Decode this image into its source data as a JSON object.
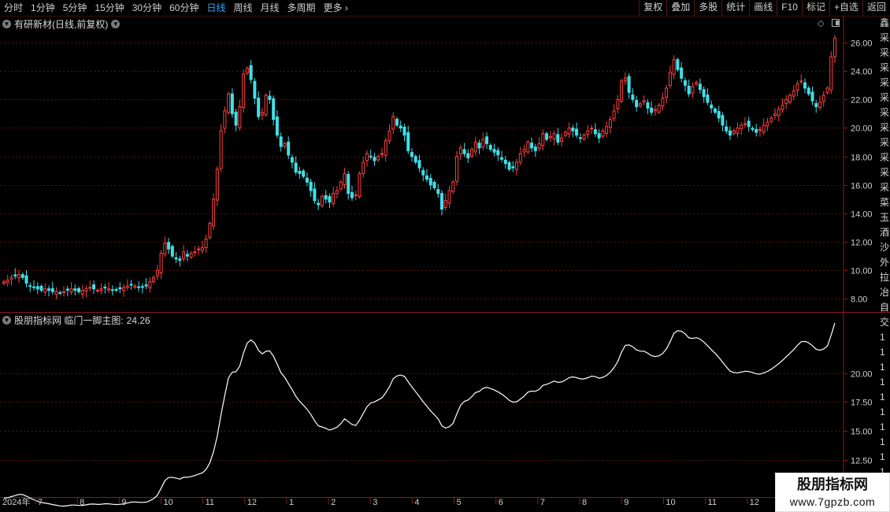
{
  "toolbar": {
    "periods": [
      "分时",
      "1分钟",
      "5分钟",
      "15分钟",
      "30分钟",
      "60分钟",
      "日线",
      "周线",
      "月线",
      "多周期",
      "更多"
    ],
    "active_period": "日线",
    "more_arrow": "›",
    "actions": [
      "复权",
      "叠加",
      "多股",
      "统计",
      "画线",
      "F10",
      "标记",
      "+自选",
      "返回"
    ]
  },
  "main_panel": {
    "title": "有研新材(日线,前复权)",
    "y_ticks": [
      "26.00",
      "24.00",
      "22.00",
      "20.00",
      "18.00",
      "16.00",
      "14.00",
      "12.00",
      "10.00",
      "8.00"
    ]
  },
  "sub_panel": {
    "title": "股朋指标网 临门一脚主图:",
    "value": "24.26",
    "y_ticks": [
      "20.00",
      "17.50",
      "15.00",
      "12.50"
    ]
  },
  "date_axis": {
    "labels": [
      "2024年",
      "7",
      "8",
      "9",
      "10",
      "11",
      "12",
      "1",
      "2",
      "3",
      "4",
      "5",
      "6",
      "7",
      "8",
      "9",
      "10",
      "11",
      "12",
      "1"
    ]
  },
  "right_strip": {
    "glyphs": [
      "鑫",
      "采",
      "采",
      "采",
      "采",
      "采",
      "采",
      "采",
      "采",
      "采",
      "采",
      "采",
      "菜",
      "玉",
      "酒",
      "沙",
      "外",
      "拉",
      "冶",
      "自",
      "交",
      "1",
      "1",
      "1",
      "1",
      "1",
      "1",
      "1",
      "1",
      "1",
      "1",
      "1",
      "1"
    ]
  },
  "watermark": {
    "line1": "股朋指标网",
    "line2": "www.7gpzb.com"
  },
  "colors": {
    "up": "#ff4040",
    "down": "#40e0e8",
    "grid": "#5a1010",
    "accent": "#2ea8ff",
    "line": "#ffffff"
  },
  "chart_data": {
    "type": "candlestick",
    "title": "有研新材(日线,前复权)",
    "y_range": [
      7.3,
      27.0
    ],
    "sub_y_range": [
      9.5,
      24.2
    ],
    "months": [
      "2024-06",
      "2024-07",
      "2024-08",
      "2024-09",
      "2024-10",
      "2024-11",
      "2024-12",
      "2025-01",
      "2025-02",
      "2025-03",
      "2025-04",
      "2025-05",
      "2025-06",
      "2025-07",
      "2025-08",
      "2025-09",
      "2025-10",
      "2025-11",
      "2025-12",
      "2026-01"
    ],
    "close": [
      9.2,
      9.3,
      9.5,
      9.6,
      9.7,
      9.5,
      9.1,
      8.9,
      8.8,
      8.7,
      8.6,
      8.7,
      8.6,
      8.5,
      8.5,
      8.4,
      8.5,
      8.6,
      8.7,
      8.6,
      8.5,
      8.6,
      8.7,
      8.8,
      8.7,
      8.6,
      8.7,
      8.8,
      8.7,
      8.6,
      8.6,
      8.7,
      8.8,
      8.9,
      9.0,
      8.9,
      8.8,
      8.8,
      8.9,
      9.2,
      9.5,
      10.0,
      11.2,
      11.9,
      11.5,
      11.0,
      10.8,
      10.7,
      11.3,
      11.0,
      11.2,
      11.3,
      11.5,
      11.6,
      12.2,
      13.3,
      15.0,
      17.1,
      19.8,
      21.2,
      22.4,
      21.0,
      20.2,
      21.5,
      23.8,
      24.2,
      23.4,
      22.1,
      20.8,
      21.1,
      22.3,
      22.0,
      20.6,
      19.5,
      18.7,
      18.9,
      18.1,
      17.6,
      16.9,
      16.8,
      16.6,
      16.2,
      15.6,
      14.9,
      14.6,
      15.2,
      15.0,
      14.8,
      15.4,
      15.6,
      16.2,
      16.8,
      15.4,
      15.1,
      15.3,
      16.8,
      17.6,
      18.2,
      18.0,
      17.7,
      18.0,
      18.2,
      19.1,
      19.8,
      20.8,
      20.2,
      20.0,
      19.5,
      18.4,
      18.0,
      17.6,
      17.2,
      16.7,
      16.4,
      16.0,
      15.8,
      15.4,
      14.3,
      14.9,
      15.6,
      16.2,
      18.0,
      18.6,
      18.2,
      17.9,
      18.5,
      19.0,
      18.6,
      19.2,
      18.9,
      18.5,
      18.3,
      18.1,
      17.8,
      17.5,
      17.1,
      17.2,
      17.6,
      18.2,
      18.5,
      19.0,
      18.6,
      18.4,
      18.9,
      19.6,
      19.2,
      19.4,
      19.6,
      19.0,
      19.3,
      19.7,
      20.0,
      19.8,
      19.5,
      19.3,
      19.5,
      19.8,
      20.0,
      19.6,
      19.3,
      19.8,
      20.1,
      20.6,
      21.2,
      22.0,
      23.3,
      23.5,
      22.5,
      22.0,
      21.5,
      21.7,
      21.9,
      21.4,
      21.1,
      21.3,
      21.6,
      22.1,
      22.8,
      23.9,
      24.8,
      24.1,
      23.5,
      23.0,
      22.4,
      22.9,
      23.2,
      22.7,
      22.2,
      21.8,
      21.4,
      21.1,
      20.7,
      20.2,
      19.8,
      19.5,
      19.8,
      20.0,
      20.2,
      20.3,
      20.1,
      19.9,
      19.7,
      19.9,
      20.2,
      20.4,
      20.7,
      21.0,
      21.3,
      21.6,
      22.0,
      22.3,
      22.6,
      23.1,
      23.3,
      22.8,
      22.4,
      21.9,
      21.5,
      21.8,
      22.3,
      22.8,
      25.0,
      26.3
    ]
  }
}
